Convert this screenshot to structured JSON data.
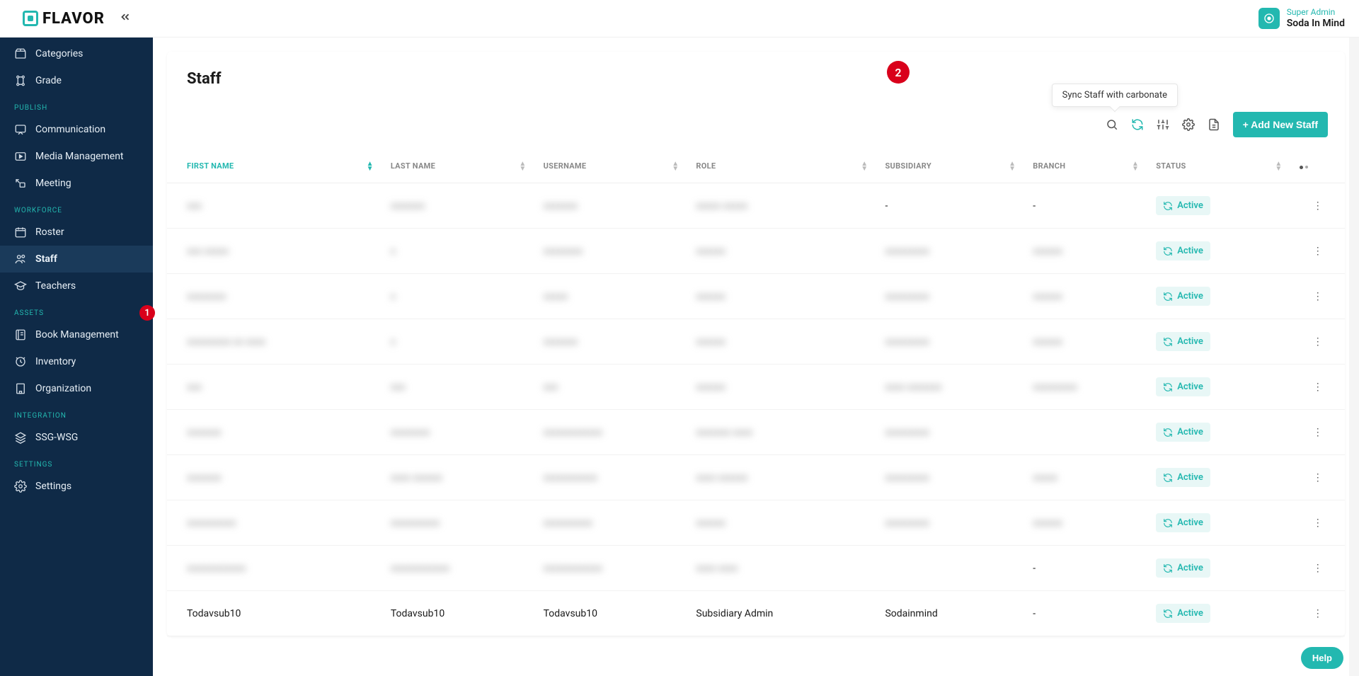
{
  "app": {
    "name": "FLAVOR"
  },
  "user": {
    "role": "Super Admin",
    "name": "Soda In Mind"
  },
  "sidebar": {
    "top": [
      {
        "label": "Categories",
        "icon": "box"
      },
      {
        "label": "Grade",
        "icon": "grade"
      }
    ],
    "sections": [
      {
        "title": "PUBLISH",
        "items": [
          {
            "label": "Communication",
            "icon": "chat"
          },
          {
            "label": "Media Management",
            "icon": "media"
          },
          {
            "label": "Meeting",
            "icon": "meeting"
          }
        ]
      },
      {
        "title": "WORKFORCE",
        "items": [
          {
            "label": "Roster",
            "icon": "calendar"
          },
          {
            "label": "Staff",
            "icon": "staff",
            "active": true
          },
          {
            "label": "Teachers",
            "icon": "grad"
          }
        ]
      },
      {
        "title": "ASSETS",
        "items": [
          {
            "label": "Book Management",
            "icon": "book"
          },
          {
            "label": "Inventory",
            "icon": "inventory"
          },
          {
            "label": "Organization",
            "icon": "org"
          }
        ]
      },
      {
        "title": "INTEGRATION",
        "items": [
          {
            "label": "SSG-WSG",
            "icon": "layers"
          }
        ]
      },
      {
        "title": "SETTINGS",
        "items": [
          {
            "label": "Settings",
            "icon": "gear"
          }
        ]
      }
    ]
  },
  "page": {
    "title": "Staff",
    "tooltip": "Sync Staff with carbonate",
    "add_button": "+ Add New Staff",
    "columns": [
      {
        "label": "FIRST NAME",
        "active": true
      },
      {
        "label": "LAST NAME"
      },
      {
        "label": "USERNAME"
      },
      {
        "label": "ROLE"
      },
      {
        "label": "SUBSIDIARY"
      },
      {
        "label": "BRANCH"
      },
      {
        "label": "STATUS"
      }
    ],
    "status_label": "Active",
    "rows": [
      {
        "first": "xxx",
        "last": "xxxxxxx",
        "user": "xxxxxxx",
        "role": "xxxxx xxxxx",
        "sub": "-",
        "branch": "-",
        "blur": true
      },
      {
        "first": "xxx xxxxx",
        "last": "x",
        "user": "xxxxxxxx",
        "role": "xxxxxx",
        "sub": "xxxxxxxxx",
        "branch": "xxxxxx",
        "blur": true
      },
      {
        "first": "xxxxxxxx",
        "last": "x",
        "user": "xxxxx",
        "role": "xxxxxx",
        "sub": "xxxxxxxxx",
        "branch": "xxxxxx",
        "blur": true
      },
      {
        "first": "xxxxxxxxx xx xxxx",
        "last": "x",
        "user": "xxxxxxx",
        "role": "xxxxxx",
        "sub": "xxxxxxxxx",
        "branch": "xxxxxx",
        "blur": true
      },
      {
        "first": "xxx",
        "last": "xxx",
        "user": "xxx",
        "role": "xxxxxx",
        "sub": "xxxx xxxxxxx",
        "branch": "xxxxxxxxx",
        "blur": true
      },
      {
        "first": "xxxxxxx",
        "last": "xxxxxxxx",
        "user": "xxxxxxxxxxxx",
        "role": "xxxxxxx xxxx",
        "sub": "xxxxxxxxx",
        "branch": "",
        "blur": true
      },
      {
        "first": "xxxxxxx",
        "last": "xxxx xxxxxx",
        "user": "xxxxxxxxxxx",
        "role": "xxxx xxxxxx",
        "sub": "xxxxxxxxx",
        "branch": "xxxxx",
        "blur": true
      },
      {
        "first": "xxxxxxxxxx",
        "last": "xxxxxxxxxx",
        "user": "xxxxxxxxxx",
        "role": "xxxxxx",
        "sub": "xxxxxxxxx",
        "branch": "xxxxxx",
        "blur": true
      },
      {
        "first": "xxxxxxxxxxxx",
        "last": "xxxxxxxxxxxx",
        "user": "xxxxxxxxxxxx",
        "role": "xxxx xxxx",
        "sub": "",
        "branch": "-",
        "blur": true
      },
      {
        "first": "Todavsub10",
        "last": "Todavsub10",
        "user": "Todavsub10",
        "role": "Subsidiary Admin",
        "sub": "Sodainmind",
        "branch": "-",
        "blur": false
      }
    ]
  },
  "annotations": {
    "one": "1",
    "two": "2"
  },
  "help": {
    "label": "Help"
  }
}
